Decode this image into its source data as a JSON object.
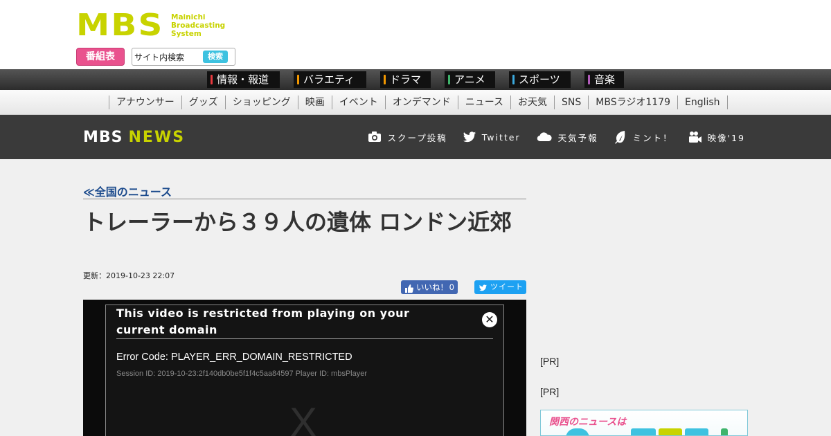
{
  "header": {
    "logo_mark": "MBS",
    "logo_text": [
      "Mainichi",
      "Broadcasting",
      "System"
    ],
    "schedule_button": "番組表",
    "search": {
      "value": "サイト内検索",
      "button": "検索"
    },
    "brand_color": "#c8d300"
  },
  "categories": [
    {
      "label": "情報・報道",
      "color": "#e8393e"
    },
    {
      "label": "バラエティ",
      "color": "#f39800"
    },
    {
      "label": "ドラマ",
      "color": "#f39800"
    },
    {
      "label": "アニメ",
      "color": "#3fb46b"
    },
    {
      "label": "スポーツ",
      "color": "#3ba9dd"
    },
    {
      "label": "音楽",
      "color": "#b15bb9"
    }
  ],
  "subnav": [
    "アナウンサー",
    "グッズ",
    "ショッピング",
    "映画",
    "イベント",
    "オンデマンド",
    "ニュース",
    "お天気",
    "SNS",
    "MBSラジオ1179",
    "English"
  ],
  "news_bar": {
    "logo_mbs": "MBS",
    "logo_news": "NEWS",
    "items": [
      {
        "label": "スクープ投稿",
        "icon": "camera-icon"
      },
      {
        "label": "Twitter",
        "icon": "twitter-icon"
      },
      {
        "label": "天気予報",
        "icon": "cloud-icon"
      },
      {
        "label": "ミント！",
        "icon": "leaf-icon"
      },
      {
        "label": "映像'19",
        "icon": "video-camera-icon"
      }
    ]
  },
  "article": {
    "breadcrumb": "≪全国のニュース",
    "title": "トレーラーから３９人の遺体 ロンドン近郊",
    "updated": "更新：2019-10-23 22:07",
    "like": {
      "label": "いいね！",
      "count": "0"
    },
    "tweet": "ツイート"
  },
  "player": {
    "error_title": "This video is restricted from playing on your current domain",
    "error_code": "Error Code: PLAYER_ERR_DOMAIN_RESTRICTED",
    "session": "Session ID: 2019-10-23:2f140db0be5f1f4c5aa84597 Player ID: mbsPlayer",
    "watermark": "X",
    "close": "✕"
  },
  "sidebar": {
    "pr": [
      "[PR]",
      "[PR]"
    ],
    "banner_text": "関西のニュースは"
  }
}
